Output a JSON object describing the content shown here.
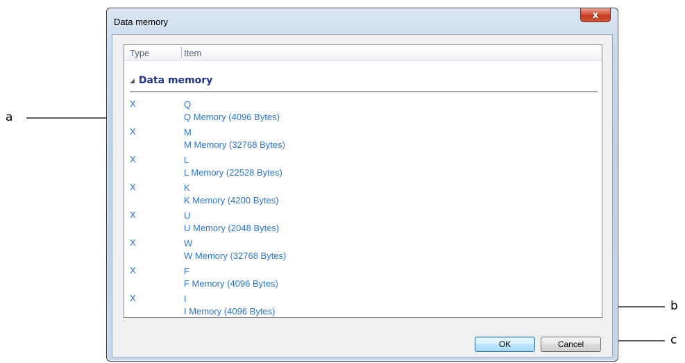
{
  "dialog": {
    "title": "Data memory",
    "close_glyph": "x",
    "ok_label": "OK",
    "cancel_label": "Cancel"
  },
  "listview": {
    "columns": [
      "Type",
      "Item"
    ],
    "group_title": "Data memory",
    "rows": [
      {
        "type": "X",
        "item": "Q",
        "desc": "Q Memory (4096 Bytes)"
      },
      {
        "type": "X",
        "item": "M",
        "desc": "M Memory (32768 Bytes)"
      },
      {
        "type": "X",
        "item": "L",
        "desc": "L Memory (22528 Bytes)"
      },
      {
        "type": "X",
        "item": "K",
        "desc": "K Memory (4200 Bytes)"
      },
      {
        "type": "X",
        "item": "U",
        "desc": "U Memory (2048 Bytes)"
      },
      {
        "type": "X",
        "item": "W",
        "desc": "W Memory (32768 Bytes)"
      },
      {
        "type": "X",
        "item": "F",
        "desc": "F Memory (4096 Bytes)"
      },
      {
        "type": "X",
        "item": "I",
        "desc": "I Memory (4096 Bytes)"
      }
    ]
  },
  "callouts": {
    "a": "a",
    "b": "b",
    "c": "c"
  },
  "colors": {
    "item_text": "#2a74d2",
    "group_header": "#1e3287",
    "close_button": "#c23a1d"
  }
}
